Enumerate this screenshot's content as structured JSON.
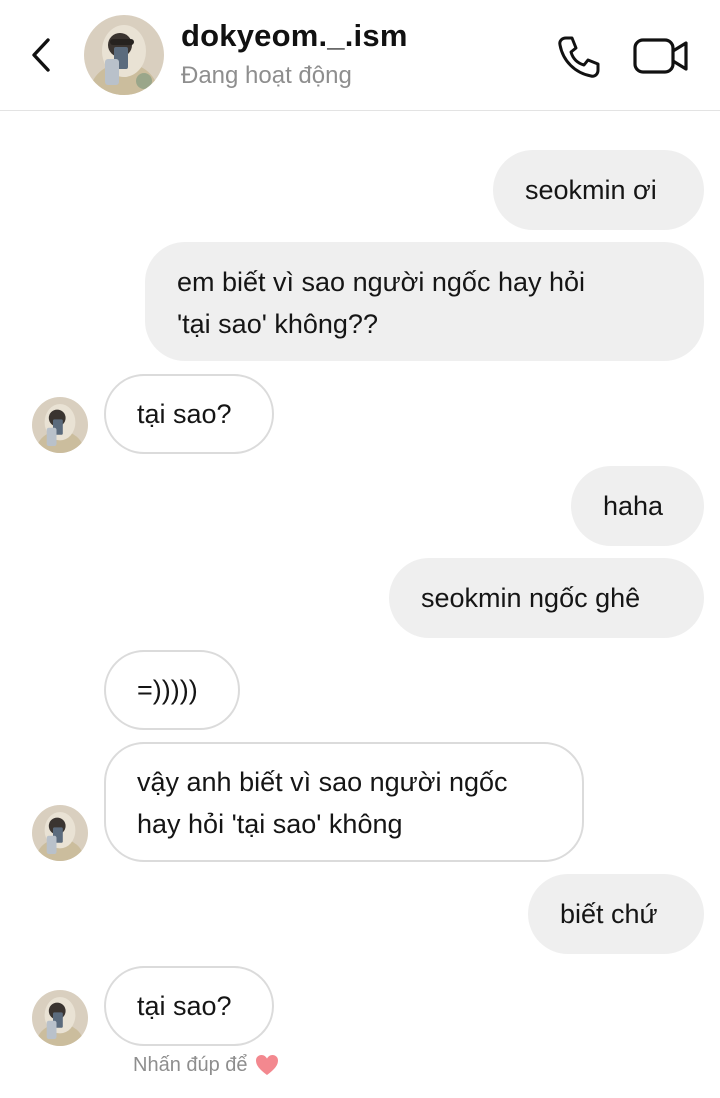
{
  "header": {
    "username": "dokyeom._.ism",
    "status": "Đang hoạt động",
    "back_icon": "chevron-left-icon",
    "call_icon": "phone-icon",
    "video_icon": "video-camera-icon"
  },
  "messages": [
    {
      "from": "me",
      "text": "seokmin ơi"
    },
    {
      "from": "me",
      "line1": "em biết vì sao người ngốc hay hỏi",
      "line2": "'tại sao' không??"
    },
    {
      "from": "them",
      "text": "tại sao?"
    },
    {
      "from": "me",
      "text": "haha"
    },
    {
      "from": "me",
      "text": "seokmin ngốc ghê"
    },
    {
      "from": "them",
      "text": "=)))))"
    },
    {
      "from": "them",
      "line1": "vậy anh biết vì sao người ngốc",
      "line2": "hay hỏi 'tại sao' không"
    },
    {
      "from": "me",
      "text": "biết chứ"
    },
    {
      "from": "them",
      "text": "tại sao?"
    }
  ],
  "hint": {
    "text": "Nhấn đúp để",
    "icon": "heart-icon",
    "heart_color": "#f3888f"
  },
  "colors": {
    "outgoing_bubble": "#efefef",
    "incoming_border": "#dbdbdb",
    "secondary_text": "#8e8e8e"
  }
}
